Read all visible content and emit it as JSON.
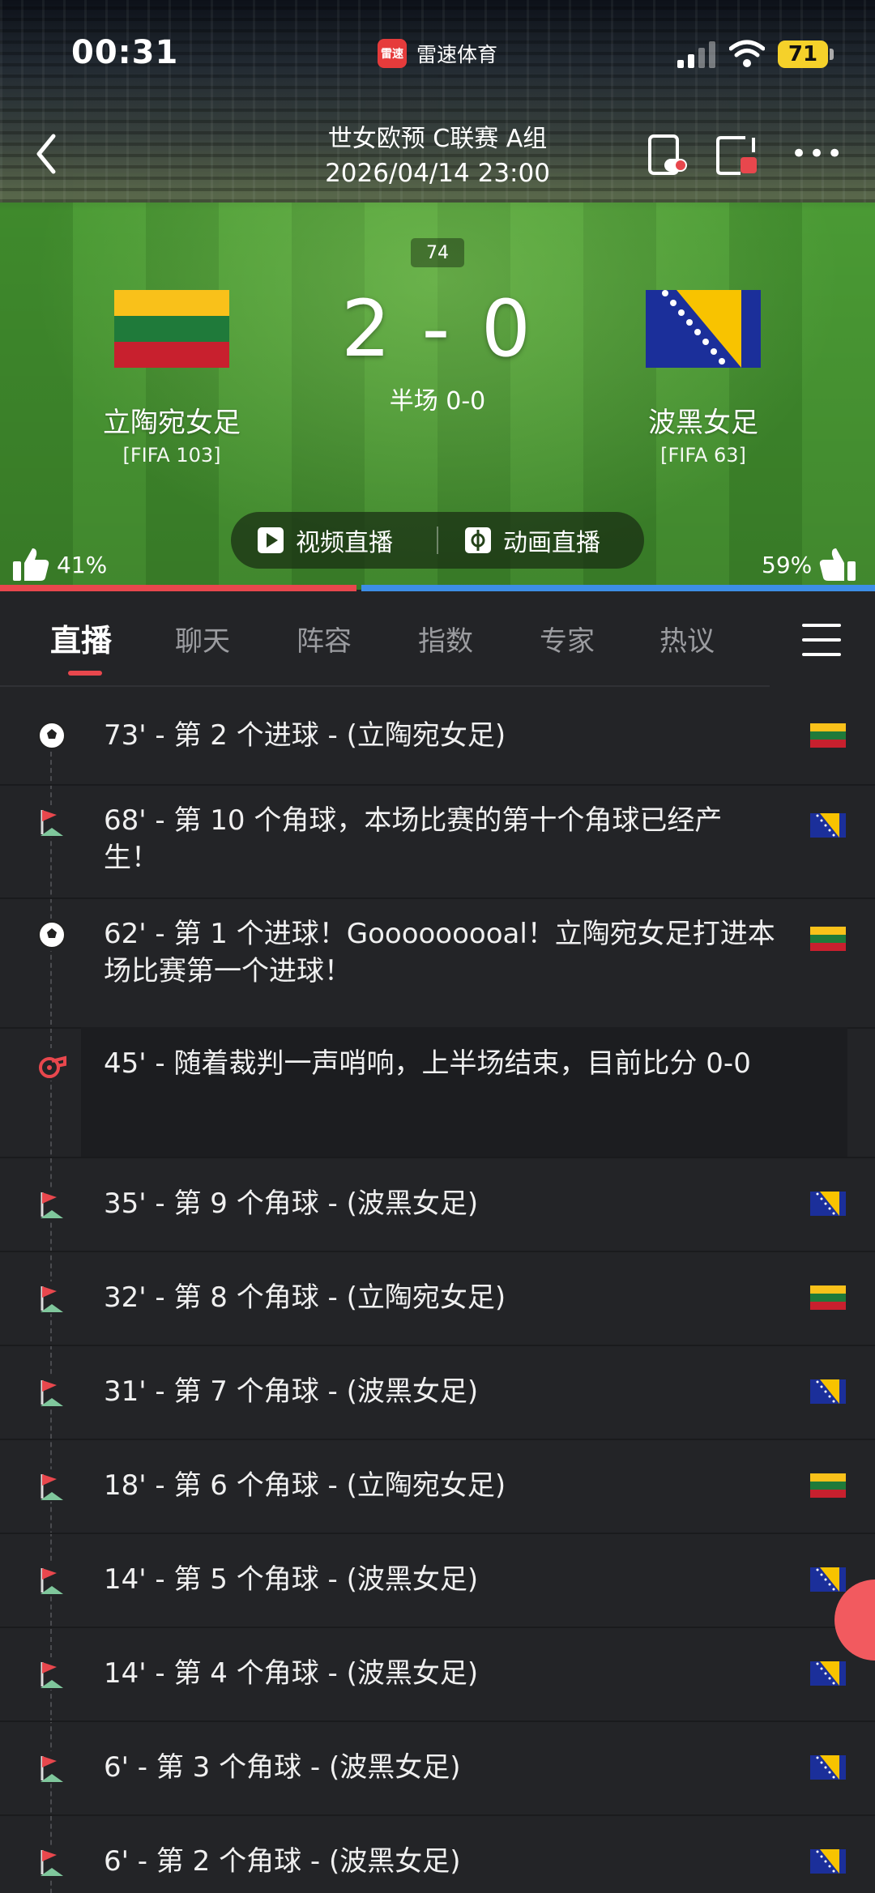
{
  "status_bar": {
    "time": "00:31",
    "app_name": "雷速体育",
    "app_logo_text": "雷速",
    "battery": "71"
  },
  "header": {
    "league": "世女欧预 C联赛 A组",
    "datetime": "2026/04/14 23:00",
    "icons": [
      "back-icon",
      "screen-record-icon",
      "pip-icon",
      "more-icon"
    ]
  },
  "match": {
    "minute": "74",
    "score": "2 - 0",
    "half_time": "半场 0-0",
    "home": {
      "name": "立陶宛女足",
      "rank": "[FIFA 103]",
      "flag": "lithuania-flag"
    },
    "away": {
      "name": "波黑女足",
      "rank": "[FIFA 63]",
      "flag": "bosnia-flag"
    },
    "live_buttons": {
      "video": "视频直播",
      "animation": "动画直播"
    },
    "vote": {
      "home": "41%",
      "away": "59%",
      "home_fraction": 0.41,
      "away_fraction": 0.59
    },
    "colors": {
      "home_bar": "#e8474d",
      "away_bar": "#3d8ee6"
    }
  },
  "tabs": [
    "直播",
    "聊天",
    "阵容",
    "指数",
    "专家",
    "热议"
  ],
  "active_tab": 0,
  "events": [
    {
      "icon": "goal-icon",
      "text": "73' - 第 2 个进球 - (立陶宛女足)",
      "team": "home"
    },
    {
      "icon": "corner-flag-icon",
      "text": "68' - 第 10 个角球，本场比赛的第十个角球已经产生！",
      "team": "away"
    },
    {
      "icon": "goal-icon",
      "text": "62' - 第 1 个进球！Gooooooooal！立陶宛女足打进本场比赛第一个进球！",
      "team": "home"
    },
    {
      "icon": "whistle-icon",
      "text": "45' - 随着裁判一声哨响，上半场结束，目前比分 0-0",
      "team": ""
    },
    {
      "icon": "corner-flag-icon",
      "text": "35' - 第 9 个角球 - (波黑女足)",
      "team": "away"
    },
    {
      "icon": "corner-flag-icon",
      "text": "32' - 第 8 个角球 - (立陶宛女足)",
      "team": "home"
    },
    {
      "icon": "corner-flag-icon",
      "text": "31' - 第 7 个角球 - (波黑女足)",
      "team": "away"
    },
    {
      "icon": "corner-flag-icon",
      "text": "18' - 第 6 个角球 - (立陶宛女足)",
      "team": "home"
    },
    {
      "icon": "corner-flag-icon",
      "text": "14' - 第 5 个角球 - (波黑女足)",
      "team": "away"
    },
    {
      "icon": "corner-flag-icon",
      "text": "14' - 第 4 个角球 - (波黑女足)",
      "team": "away"
    },
    {
      "icon": "corner-flag-icon",
      "text": "6' - 第 3 个角球 - (波黑女足)",
      "team": "away"
    },
    {
      "icon": "corner-flag-icon",
      "text": "6' - 第 2 个角球 - (波黑女足)",
      "team": "away"
    }
  ]
}
